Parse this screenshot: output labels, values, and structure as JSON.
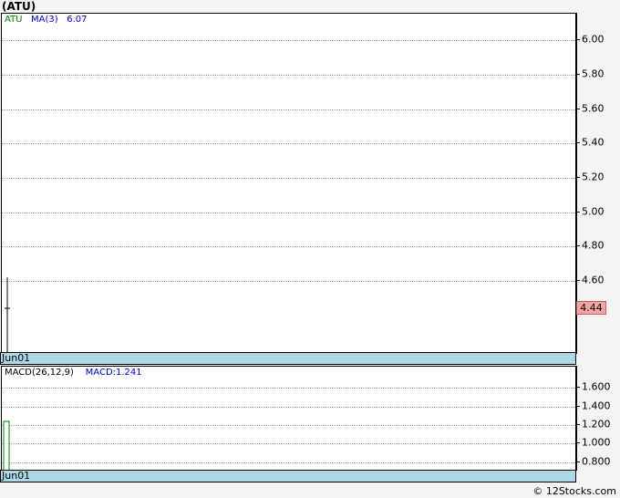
{
  "title": "(ATU)",
  "footer": "© 12Stocks.com",
  "price_panel": {
    "legend": {
      "symbol": "ATU",
      "ma_label": "MA(3)",
      "ma_value": "6.07"
    },
    "date_label": "Jun01",
    "last_price_label": "4.44",
    "colors": {
      "symbol": "#008000",
      "ma": "#0000cc",
      "last_price_bg": "#f4a6a6"
    }
  },
  "macd_panel": {
    "legend": {
      "params": "MACD(26,12,9)",
      "value": "MACD:1.241"
    },
    "date_label": "Jun01",
    "colors": {
      "params": "#000000",
      "value": "#0000cc",
      "bar": "#008000"
    }
  },
  "chart_data": [
    {
      "type": "candlestick",
      "ylim": [
        4.18,
        6.15
      ],
      "yticks": [
        4.6,
        4.8,
        5.0,
        5.2,
        5.4,
        5.6,
        5.8,
        6.0
      ],
      "ytick_labels": [
        "4.60",
        "4.80",
        "5.00",
        "5.20",
        "5.40",
        "5.60",
        "5.80",
        "6.00"
      ],
      "grid": true,
      "categories": [
        "Jun01"
      ],
      "ohlc": [
        {
          "date": "Jun01",
          "open": 4.44,
          "high": 4.62,
          "low": 4.18,
          "close": 4.44
        }
      ],
      "ma3": 6.07,
      "last_price": 4.44
    },
    {
      "type": "bar",
      "ylim": [
        0.7,
        1.82
      ],
      "yticks": [
        0.8,
        1.0,
        1.2,
        1.4,
        1.6
      ],
      "ytick_labels": [
        "0.800",
        "1.000",
        "1.200",
        "1.400",
        "1.600"
      ],
      "grid": true,
      "categories": [
        "Jun01"
      ],
      "values": [
        1.241
      ]
    }
  ]
}
